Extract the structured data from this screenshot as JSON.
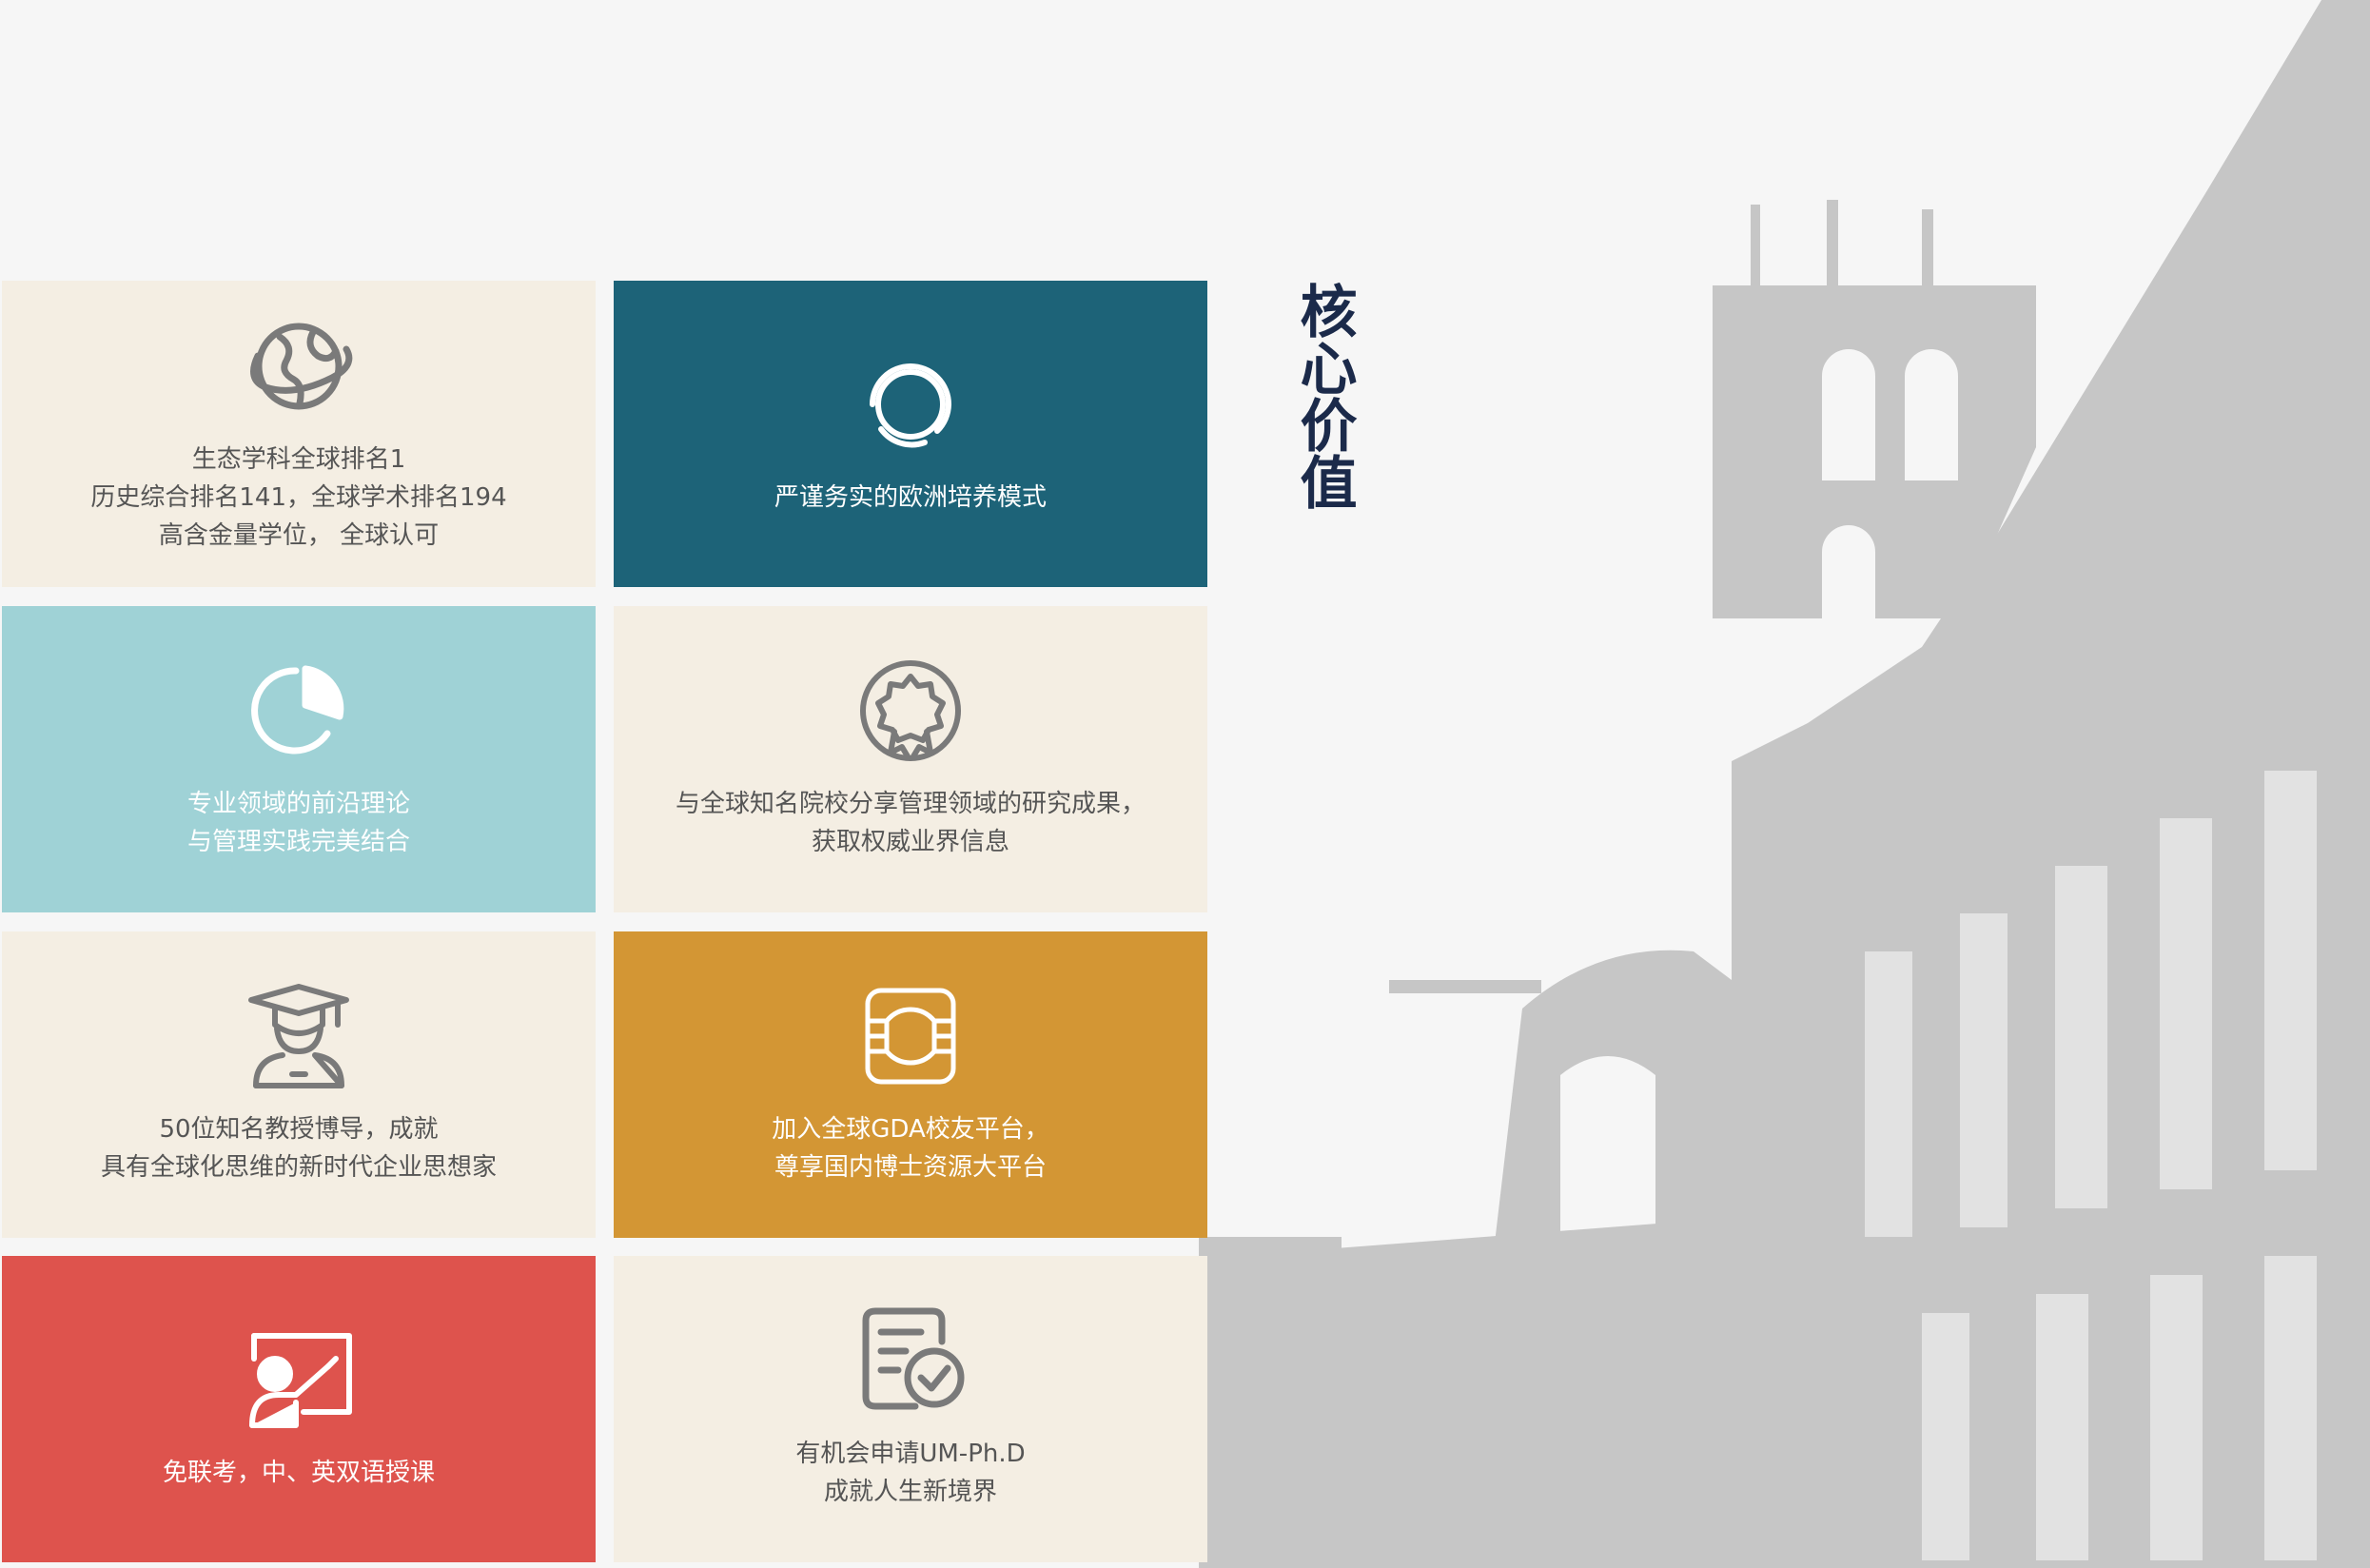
{
  "title": "核心价值",
  "colors": {
    "background": "#f6f6f6",
    "beige": "#f4eee3",
    "teal": "#1d6378",
    "light_blue": "#9fd2d6",
    "mustard": "#d39634",
    "red": "#de534d",
    "title": "#1b2a4a",
    "building": "#c6c6c6"
  },
  "tiles": [
    {
      "icon": "globe-icon",
      "color": "#f4eee3",
      "lines": [
        "生态学科全球排名1",
        "历史综合排名141，全球学术排名194",
        "高含金量学位， 全球认可"
      ]
    },
    {
      "icon": "ring-icon",
      "color": "#1d6378",
      "lines": [
        "严谨务实的欧洲培养模式"
      ]
    },
    {
      "icon": "pie-chart-icon",
      "color": "#9fd2d6",
      "lines": [
        "专业领域的前沿理论",
        "与管理实践完美结合"
      ]
    },
    {
      "icon": "award-badge-icon",
      "color": "#f4eee3",
      "lines": [
        "与全球知名院校分享管理领域的研究成果，",
        "获取权威业界信息"
      ]
    },
    {
      "icon": "graduate-icon",
      "color": "#f4eee3",
      "lines": [
        "50位知名教授博导，成就",
        "具有全球化思维的新时代企业思想家"
      ]
    },
    {
      "icon": "network-frame-icon",
      "color": "#d39634",
      "lines": [
        "加入全球GDA校友平台，",
        "尊享国内博士资源大平台"
      ]
    },
    {
      "icon": "teacher-board-icon",
      "color": "#de534d",
      "lines": [
        "免联考，中、英双语授课"
      ]
    },
    {
      "icon": "document-check-icon",
      "color": "#f4eee3",
      "lines": [
        "有机会申请UM-Ph.D",
        "成就人生新境界"
      ]
    }
  ]
}
